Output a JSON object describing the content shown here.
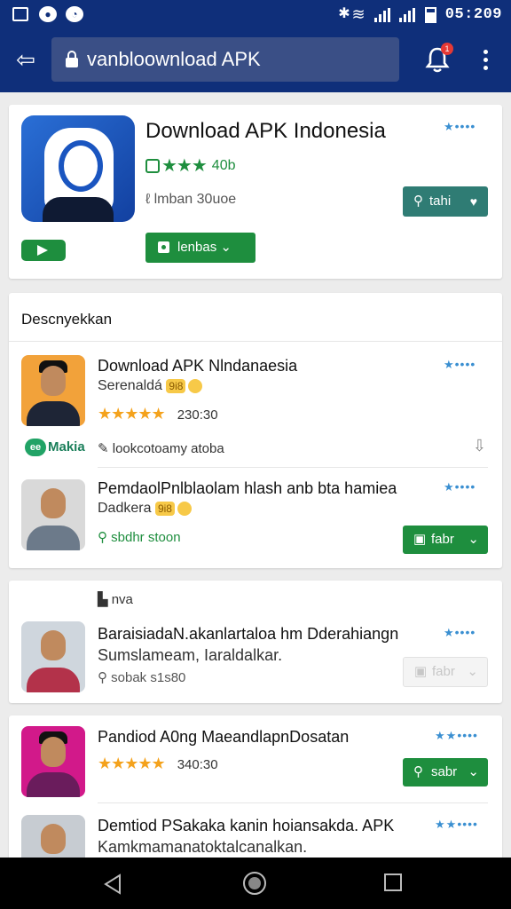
{
  "status_bar": {
    "time": "05:209"
  },
  "browser": {
    "url": "vanbloownload APK",
    "notification_count": "1"
  },
  "hero": {
    "title": "Download APK Indonesia",
    "rating": "40b",
    "meta": "lmban 30uoe",
    "download_label": "lenbas",
    "action_label": "tahi"
  },
  "list_section": {
    "title": "Descnyekkan",
    "brand_label": "Makia",
    "items": [
      {
        "title": "Download APK Nlndanaesia",
        "subtitle": "Serenaldá",
        "emoji": "9i8",
        "rating_value": "230:30",
        "meta": "lookcotoamy atoba"
      },
      {
        "title": "PemdaolPnlblaolam hlash anb bta hamiea",
        "subtitle": "Dadkera",
        "emoji": "9i8",
        "meta": "sbdhr stoon",
        "button_label": "fabr"
      }
    ]
  },
  "section2": {
    "header_label": "nva",
    "items": [
      {
        "title": "BaraisiadaN.akanlartaloa hm Dderahiangn",
        "subtitle": "Sumslameam, Iaraldalkar.",
        "meta": "sobak s1s80",
        "button_label": "fabr"
      }
    ]
  },
  "section3": {
    "items": [
      {
        "title": "Pandiod A0ng MaeandlapnDosatan",
        "rating_value": "340:30",
        "button_label": "sabr"
      },
      {
        "title": "Demtiod PSakaka kanin hoiansakda. APK",
        "subtitle": "Kamkmamanatoktalcanalkan."
      }
    ]
  }
}
